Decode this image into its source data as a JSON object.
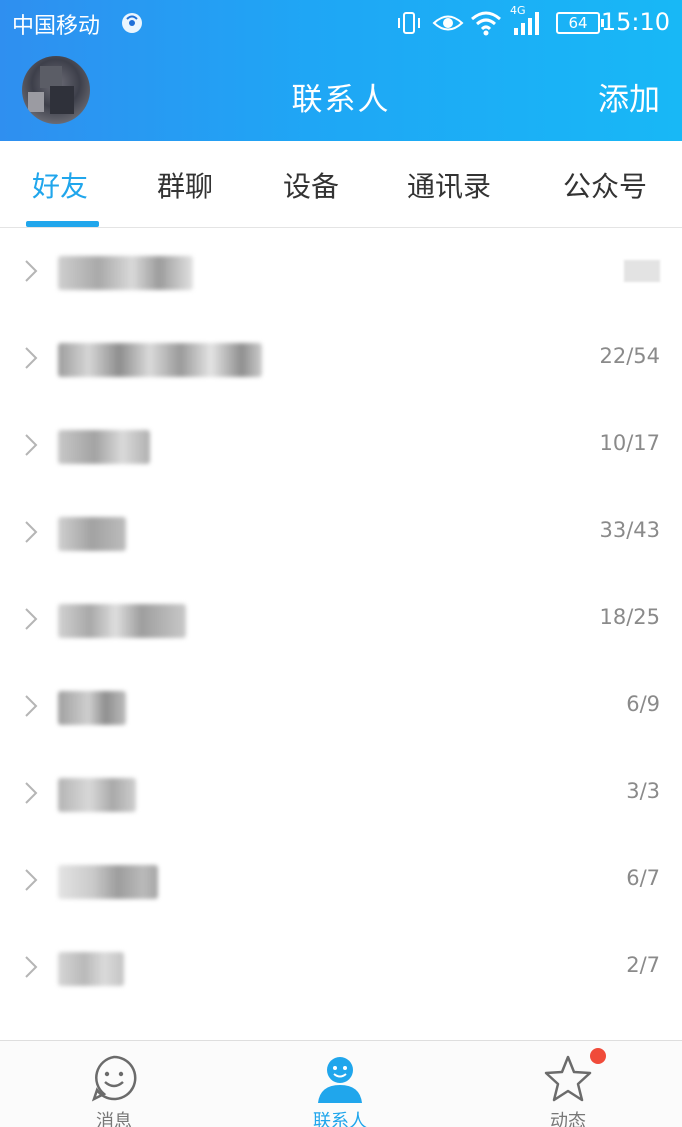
{
  "statusbar": {
    "carrier": "中国移动",
    "network_label": "4G",
    "battery": "64",
    "time": "15:10"
  },
  "header": {
    "title": "联系人",
    "add_label": "添加"
  },
  "tabs": [
    {
      "label": "好友",
      "active": true
    },
    {
      "label": "群聊"
    },
    {
      "label": "设备"
    },
    {
      "label": "通讯录"
    },
    {
      "label": "公众号"
    }
  ],
  "groups": [
    {
      "count": ""
    },
    {
      "count": "22/54"
    },
    {
      "count": "10/17"
    },
    {
      "count": "33/43"
    },
    {
      "count": "18/25"
    },
    {
      "count": "6/9"
    },
    {
      "count": "3/3"
    },
    {
      "count": "6/7"
    },
    {
      "count": "2/7"
    }
  ],
  "bottom_nav": [
    {
      "label": "消息",
      "icon": "smile-chat-icon"
    },
    {
      "label": "联系人",
      "icon": "person-icon",
      "active": true
    },
    {
      "label": "动态",
      "icon": "star-icon",
      "badge": true
    }
  ],
  "colors": {
    "accent": "#20a6ec",
    "header_start": "#2f8ff0",
    "header_end": "#18b8f6",
    "badge": "#f04b3a"
  }
}
